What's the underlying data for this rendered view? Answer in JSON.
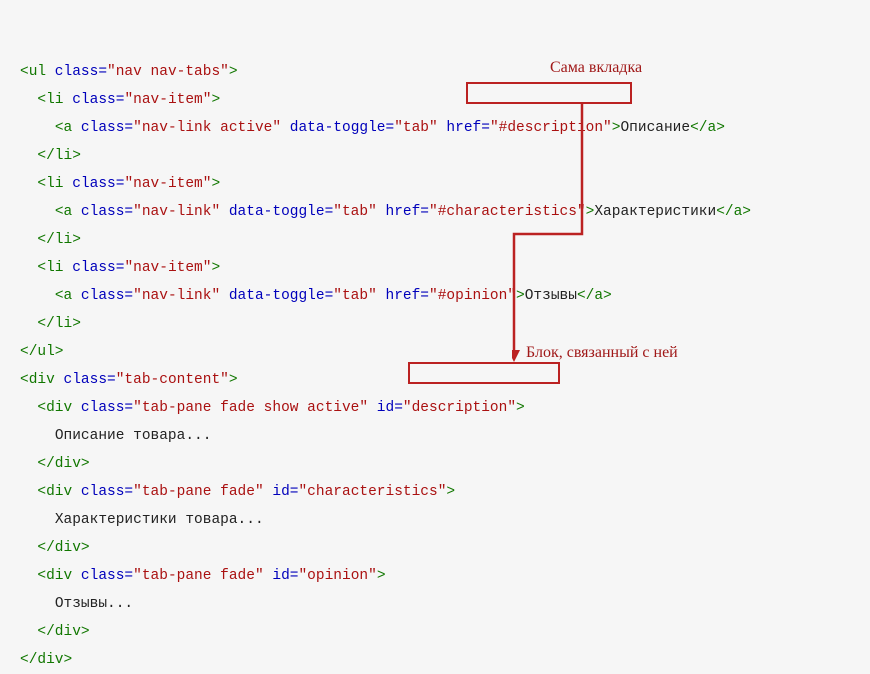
{
  "annotations": {
    "top": "Сама вкладка",
    "bottom": "Блок, связанный с ней"
  },
  "code": {
    "l1": {
      "tag_open": "<ul",
      "attr": " class=",
      "val": "\"nav nav-tabs\"",
      "close": ">"
    },
    "l2": {
      "tag_open": "<li",
      "attr": " class=",
      "val": "\"nav-item\"",
      "close": ">"
    },
    "l3": {
      "tag_open": "<a",
      "a1n": " class=",
      "a1v": "\"nav-link active\"",
      "a2n": " data-toggle=",
      "a2v": "\"tab\"",
      "a3n": " href=",
      "a3v": "\"#description\"",
      "close": ">",
      "text": "Описание",
      "end": "</a>"
    },
    "l4": {
      "end": "</li>"
    },
    "l5": {
      "tag_open": "<li",
      "attr": " class=",
      "val": "\"nav-item\"",
      "close": ">"
    },
    "l6": {
      "tag_open": "<a",
      "a1n": " class=",
      "a1v": "\"nav-link\"",
      "a2n": " data-toggle=",
      "a2v": "\"tab\"",
      "a3n": " href=",
      "a3v": "\"#characteristics\"",
      "close": ">",
      "text": "Характеристики",
      "end": "</a>"
    },
    "l7": {
      "end": "</li>"
    },
    "l8": {
      "tag_open": "<li",
      "attr": " class=",
      "val": "\"nav-item\"",
      "close": ">"
    },
    "l9": {
      "tag_open": "<a",
      "a1n": " class=",
      "a1v": "\"nav-link\"",
      "a2n": " data-toggle=",
      "a2v": "\"tab\"",
      "a3n": " href=",
      "a3v": "\"#opinion\"",
      "close": ">",
      "text": "Отзывы",
      "end": "</a>"
    },
    "l10": {
      "end": "</li>"
    },
    "l11": {
      "end": "</ul>"
    },
    "l12": {
      "tag_open": "<div",
      "attr": " class=",
      "val": "\"tab-content\"",
      "close": ">"
    },
    "l13": {
      "tag_open": "<div",
      "a1n": " class=",
      "a1v": "\"tab-pane fade show active\"",
      "a2n": " id=",
      "a2v": "\"description\"",
      "close": ">"
    },
    "l14": {
      "text": "Описание товара..."
    },
    "l15": {
      "end": "</div>"
    },
    "l16": {
      "tag_open": "<div",
      "a1n": " class=",
      "a1v": "\"tab-pane fade\"",
      "a2n": " id=",
      "a2v": "\"characteristics\"",
      "close": ">"
    },
    "l17": {
      "text": "Характеристики товара..."
    },
    "l18": {
      "end": "</div>"
    },
    "l19": {
      "tag_open": "<div",
      "a1n": " class=",
      "a1v": "\"tab-pane fade\"",
      "a2n": " id=",
      "a2v": "\"opinion\"",
      "close": ">"
    },
    "l20": {
      "text": "Отзывы..."
    },
    "l21": {
      "end": "</div>"
    },
    "l22": {
      "end": "</div>"
    }
  }
}
